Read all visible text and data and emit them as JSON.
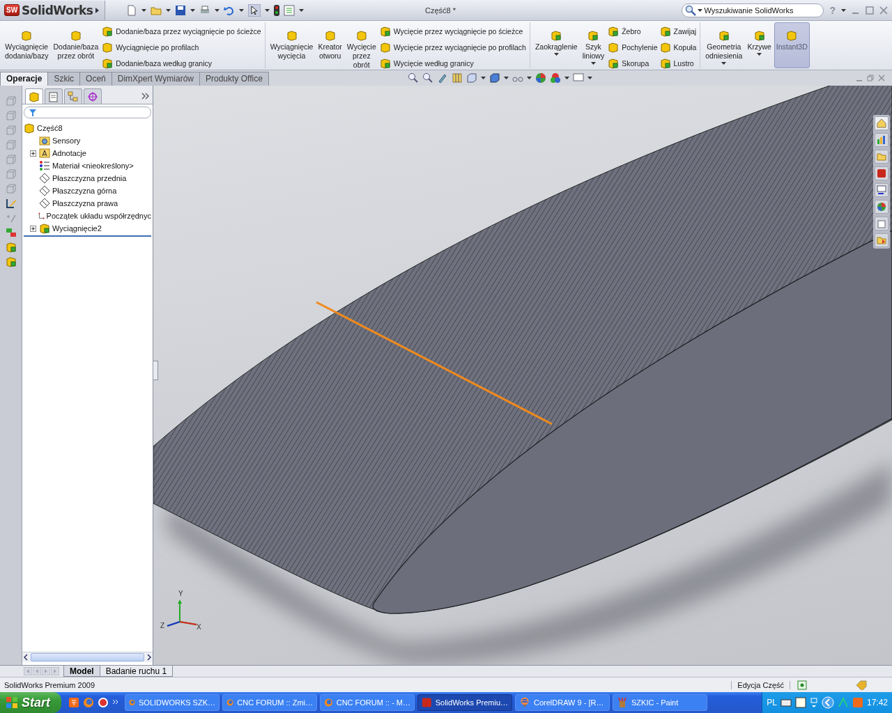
{
  "title_bar": {
    "logo_badge": "SW",
    "logo": "SolidWorks",
    "document_title": "Część8 *",
    "search": {
      "placeholder": "Wyszukiwanie SolidWorks"
    },
    "help": "?"
  },
  "ribbon": {
    "groups": [
      {
        "columns": [
          {
            "kind": "large",
            "label": "Wyciągnięcie\ndodania/bazy",
            "dropdown": false,
            "selected": false
          },
          {
            "kind": "large",
            "label": "Dodanie/baza\nprzez obrót",
            "dropdown": false,
            "selected": false
          },
          {
            "kind": "stack",
            "items": [
              "Dodanie/baza przez wyciągnięcie po ścieżce",
              "Wyciągnięcie po profilach",
              "Dodanie/baza według granicy"
            ]
          }
        ]
      },
      {
        "columns": [
          {
            "kind": "large",
            "label": "Wyciągnięcie\nwycięcia",
            "dropdown": false,
            "selected": false
          },
          {
            "kind": "large",
            "label": "Kreator\notworu",
            "dropdown": false,
            "selected": false
          },
          {
            "kind": "large",
            "label": "Wycięcie\nprzez\nobrót",
            "dropdown": false,
            "selected": false
          },
          {
            "kind": "stack",
            "items": [
              "Wycięcie przez wyciągnięcie po ścieżce",
              "Wycięcie przez wyciągnięcie po profilach",
              "Wycięcie według granicy"
            ]
          }
        ]
      },
      {
        "columns": [
          {
            "kind": "large",
            "label": "Zaokrąglenie",
            "dropdown": true,
            "selected": false
          },
          {
            "kind": "large",
            "label": "Szyk\nliniowy",
            "dropdown": true,
            "selected": false
          },
          {
            "kind": "stack",
            "items": [
              "Żebro",
              "Pochylenie",
              "Skorupa"
            ]
          },
          {
            "kind": "stack",
            "items": [
              "Zawijaj",
              "Kopuła",
              "Lustro"
            ]
          }
        ]
      },
      {
        "columns": [
          {
            "kind": "large",
            "label": "Geometria\nodniesienia",
            "dropdown": true,
            "selected": false
          },
          {
            "kind": "large",
            "label": "Krzywe",
            "dropdown": true,
            "selected": false
          },
          {
            "kind": "large",
            "label": "Instant3D",
            "dropdown": false,
            "selected": true
          }
        ]
      }
    ]
  },
  "command_tabs": [
    {
      "label": "Operacje",
      "selected": true
    },
    {
      "label": "Szkic",
      "selected": false
    },
    {
      "label": "Oceń",
      "selected": false
    },
    {
      "label": "DimXpert Wymiarów",
      "selected": false
    },
    {
      "label": "Produkty Office",
      "selected": false
    }
  ],
  "feature_tree": {
    "root": "Część8",
    "children": [
      {
        "label": "Sensory",
        "kind": "sensors",
        "expandable": false
      },
      {
        "label": "Adnotacje",
        "kind": "annotations",
        "expandable": true
      },
      {
        "label": "Materiał <nieokreślony>",
        "kind": "material",
        "expandable": false
      },
      {
        "label": "Płaszczyzna przednia",
        "kind": "plane",
        "expandable": false
      },
      {
        "label": "Płaszczyzna górna",
        "kind": "plane",
        "expandable": false
      },
      {
        "label": "Płaszczyzna prawa",
        "kind": "plane",
        "expandable": false
      },
      {
        "label": "Początek układu współrzędnyc",
        "kind": "origin",
        "expandable": false
      },
      {
        "label": "Wyciągnięcie2",
        "kind": "extrude",
        "expandable": true
      }
    ]
  },
  "viewport": {
    "triad": {
      "y": "Y",
      "z": "Z",
      "x": "X"
    }
  },
  "bottom_tabs": [
    {
      "label": "Model",
      "selected": true
    },
    {
      "label": "Badanie ruchu 1",
      "selected": false
    }
  ],
  "status_bar": {
    "product": "SolidWorks Premium 2009",
    "mode": "Edycja Część"
  },
  "taskbar": {
    "start": "Start",
    "tasks": [
      {
        "label": "SOLIDWORKS SZK…",
        "kind": "browser",
        "selected": false
      },
      {
        "label": "CNC FORUM :: Zmi…",
        "kind": "browser",
        "selected": false
      },
      {
        "label": "CNC FORUM :: - M…",
        "kind": "browser",
        "selected": false
      },
      {
        "label": "SolidWorks Premiu…",
        "kind": "cad",
        "selected": true
      },
      {
        "label": "CorelDRAW 9 - [R…",
        "kind": "balloon",
        "selected": false
      },
      {
        "label": "SZKIC - Paint",
        "kind": "paint",
        "selected": false
      }
    ],
    "language": "PL",
    "clock": "17:42"
  }
}
